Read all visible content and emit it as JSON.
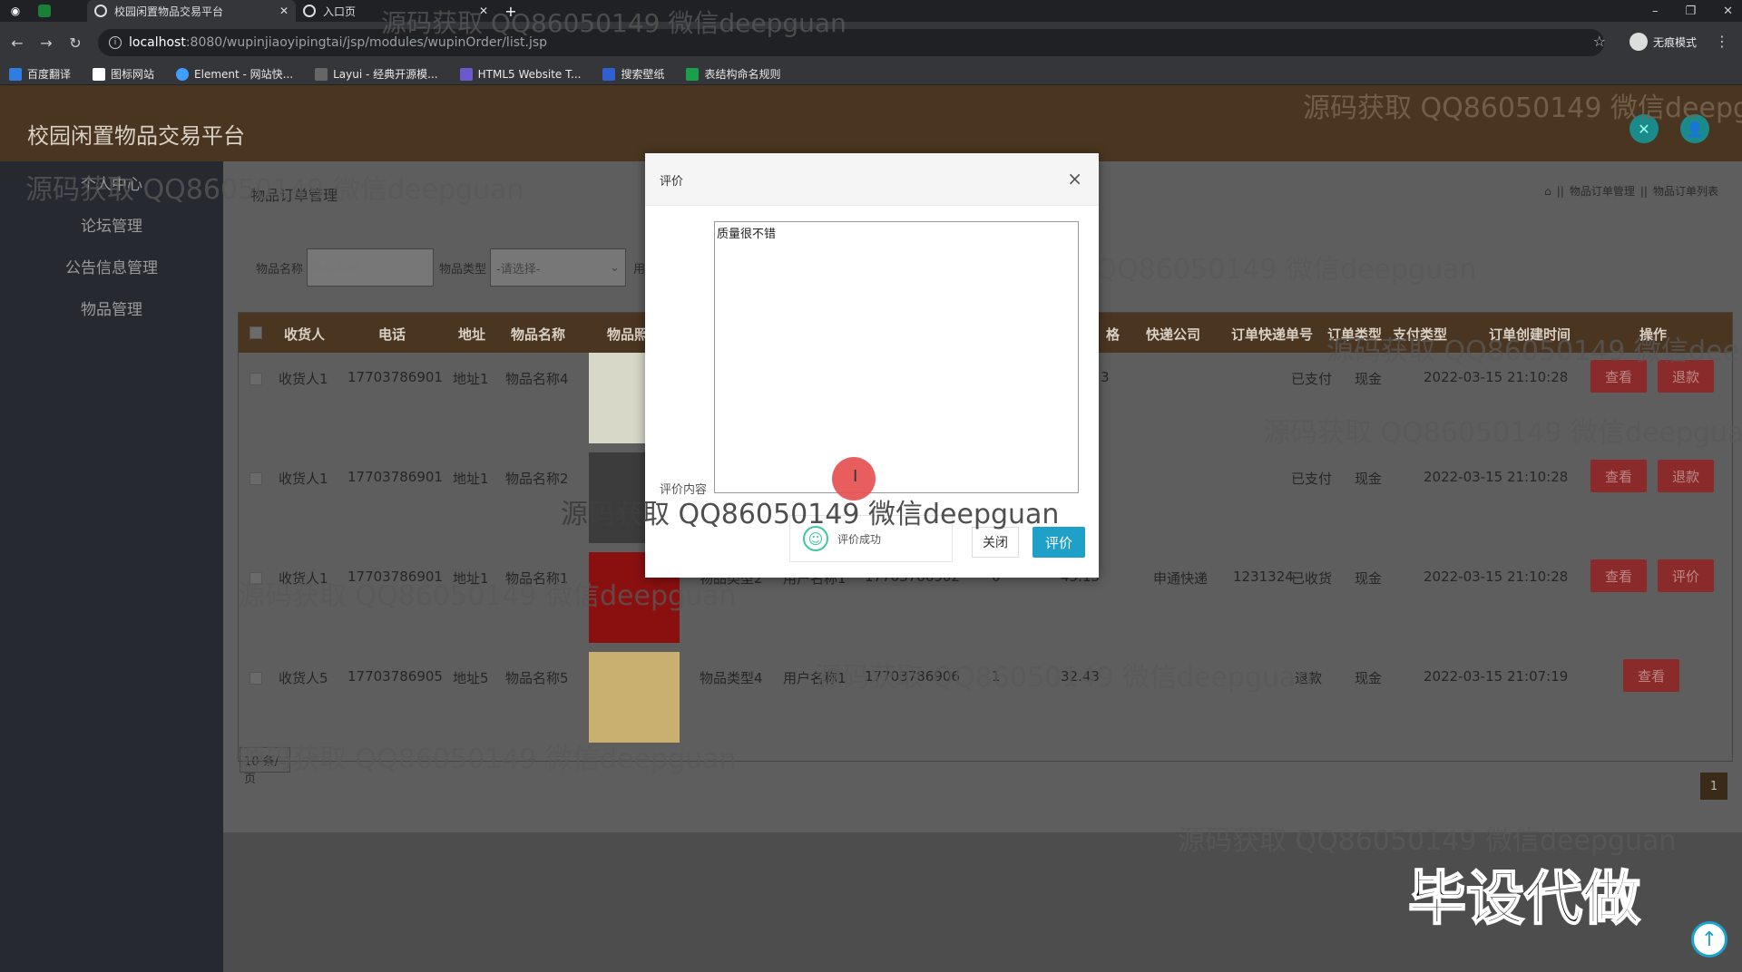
{
  "browser": {
    "tabs": [
      {
        "title": "校园闲置物品交易平台"
      },
      {
        "title": "入口页"
      }
    ],
    "url_host": "localhost",
    "url_path": ":8080/wupinjiaoyipingtai/jsp/modules/wupinOrder/list.jsp",
    "incognito_label": "无痕模式",
    "bookmarks": [
      "百度翻译",
      "图标网站",
      "Element - 网站快...",
      "Layui - 经典开源模...",
      "HTML5 Website T...",
      "搜索壁纸",
      "表结构命名规则"
    ]
  },
  "app": {
    "title": "校园闲置物品交易平台",
    "sidebar": [
      "个人中心",
      "论坛管理",
      "公告信息管理",
      "物品管理"
    ],
    "page_heading": "物品订单管理",
    "breadcrumb": [
      "物品订单管理",
      "物品订单列表"
    ],
    "search": {
      "name_label": "物品名称",
      "name_placeholder": "物品名称",
      "type_label": "物品类型",
      "type_value": "-请选择-",
      "trailing_label": "用"
    },
    "table": {
      "headers": [
        "收货人",
        "电话",
        "地址",
        "物品名称",
        "物品照",
        "格",
        "快递公司",
        "订单快递单号",
        "订单类型",
        "支付类型",
        "订单创建时间",
        "操作"
      ],
      "rows": [
        {
          "receiver": "收货人1",
          "phone": "17703786901",
          "address": "地址1",
          "name": "物品名称4",
          "type": "",
          "user": "",
          "user_phone": "",
          "qty": "",
          "price": "3",
          "courier": "",
          "tracking": "",
          "order_type": "已支付",
          "pay_type": "现金",
          "created": "2022-03-15 21:10:28",
          "actions": [
            "查看",
            "退款"
          ]
        },
        {
          "receiver": "收货人1",
          "phone": "17703786901",
          "address": "地址1",
          "name": "物品名称2",
          "type": "",
          "user": "",
          "user_phone": "",
          "qty": "",
          "price": "",
          "courier": "",
          "tracking": "",
          "order_type": "已支付",
          "pay_type": "现金",
          "created": "2022-03-15 21:10:28",
          "actions": [
            "查看",
            "退款"
          ]
        },
        {
          "receiver": "收货人1",
          "phone": "17703786901",
          "address": "地址1",
          "name": "物品名称1",
          "type": "物品类型2",
          "user": "用户名称1",
          "user_phone": "17703786902",
          "qty": "0",
          "price": "45.13",
          "courier": "申通快递",
          "tracking": "1231324",
          "order_type": "已收货",
          "pay_type": "现金",
          "created": "2022-03-15 21:10:28",
          "actions": [
            "查看",
            "评价"
          ]
        },
        {
          "receiver": "收货人5",
          "phone": "17703786905",
          "address": "地址5",
          "name": "物品名称5",
          "type": "物品类型4",
          "user": "用户名称1",
          "user_phone": "17703786906",
          "qty": "1",
          "price": "32.43",
          "courier": "",
          "tracking": "",
          "order_type": "退款",
          "pay_type": "现金",
          "created": "2022-03-15 21:07:19",
          "actions": [
            "查看"
          ]
        }
      ]
    },
    "pager": {
      "size_label": "10",
      "size_suffix": "条/页",
      "current_page": "1"
    }
  },
  "modal": {
    "title": "评价",
    "field_label": "评价内容",
    "textarea_value": "质量很不错",
    "toast_text": "评价成功",
    "close_label": "关闭",
    "submit_label": "评价"
  },
  "watermarks": {
    "text": "源码获取 QQ86050149 微信deepguan",
    "stamp": "毕设代做"
  },
  "colors": {
    "header_brown": "#4a3620",
    "primary_button": "#1fa0c8",
    "danger_button": "#8b2a2a",
    "success_icon": "#3ec4a7"
  }
}
